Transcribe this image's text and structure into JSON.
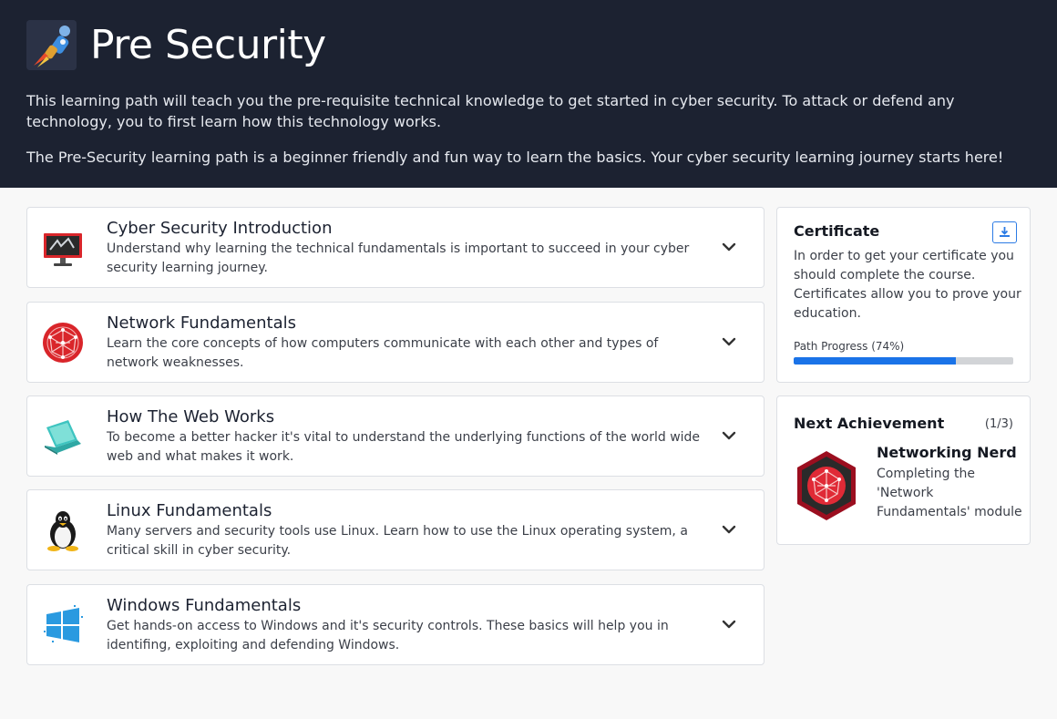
{
  "header": {
    "title": "Pre Security",
    "description_1": "This learning path will teach you the pre-requisite technical knowledge to get started in cyber security. To attack or defend any technology, you to first learn how this technology works.",
    "description_2": "The Pre-Security learning path is a beginner friendly and fun way to learn the basics. Your cyber security learning journey starts here!",
    "logo_icon": "astronaut-rocket-icon"
  },
  "modules": [
    {
      "title": "Cyber Security Introduction",
      "description": "Understand why learning the technical fundamentals is important to succeed in your cyber security learning journey.",
      "icon": "monitor-icon"
    },
    {
      "title": "Network Fundamentals",
      "description": "Learn the core concepts of how computers communicate with each other and types of network weaknesses.",
      "icon": "network-globe-icon"
    },
    {
      "title": "How The Web Works",
      "description": "To become a better hacker it's vital to understand the underlying functions of the world wide web and what makes it work.",
      "icon": "laptop-icon"
    },
    {
      "title": "Linux Fundamentals",
      "description": "Many servers and security tools use Linux. Learn how to use the Linux operating system, a critical skill in cyber security.",
      "icon": "tux-penguin-icon"
    },
    {
      "title": "Windows Fundamentals",
      "description": "Get hands-on access to Windows and it's security controls. These basics will help you in identifing, exploiting and defending Windows.",
      "icon": "windows-logo-icon"
    }
  ],
  "certificate": {
    "title": "Certificate",
    "text": "In order to get your certificate you should complete the course. Certificates allow you to prove your education.",
    "progress_label": "Path Progress (74%)",
    "progress": 0.74,
    "download_icon": "download-icon"
  },
  "achievement": {
    "title": "Next Achievement",
    "count": "(1/3)",
    "name": "Networking Nerd",
    "description": "Completing the 'Network Fundamentals' module",
    "badge_icon": "network-badge-icon"
  },
  "colors": {
    "header_bg": "#1c2231",
    "accent": "#1a73e8",
    "badge_red": "#c8102e"
  }
}
